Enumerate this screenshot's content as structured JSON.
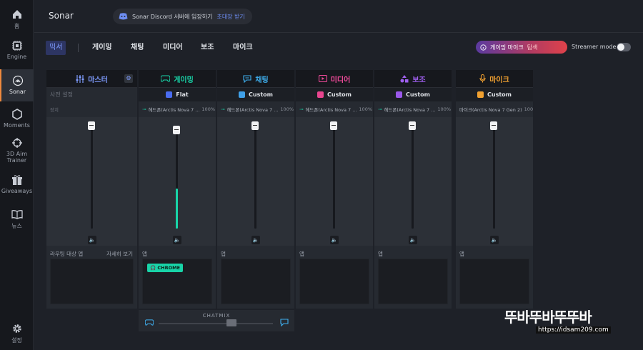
{
  "sidebar": {
    "items": [
      {
        "label": "홈",
        "icon": "home-icon"
      },
      {
        "label": "Engine",
        "icon": "chip-icon"
      },
      {
        "label": "Sonar",
        "icon": "sonar-icon"
      },
      {
        "label": "Moments",
        "icon": "hexagon-icon"
      },
      {
        "label": "3D Aim",
        "label2": "Trainer",
        "icon": "aim-icon"
      },
      {
        "label": "Giveaways",
        "icon": "gift-icon"
      },
      {
        "label": "뉴스",
        "icon": "book-icon"
      },
      {
        "label": "설정",
        "icon": "gear-icon"
      }
    ]
  },
  "header": {
    "title": "Sonar",
    "discord": {
      "text": "Sonar Discord 서버에 입장하기",
      "link": "초대장 받기"
    }
  },
  "tabs": [
    {
      "label": "믹서"
    },
    {
      "label": "게이밍"
    },
    {
      "label": "채팅"
    },
    {
      "label": "미디어"
    },
    {
      "label": "보조"
    },
    {
      "label": "마이크"
    }
  ],
  "gaming_mic": {
    "text": "게이밍 마이크",
    "action": "탐색"
  },
  "streamer_mode": "Streamer mode",
  "master": {
    "label": "마스터",
    "preset_label": "사전 설정",
    "device_label": "장치",
    "apps_label": "라우팅 대상 앱",
    "details_link": "자세히 보기"
  },
  "channels": [
    {
      "key": "gaming",
      "label": "게이밍",
      "color": "#18d4a8",
      "preset": "Flat",
      "preset_color": "#4a6cf0",
      "device": "헤드폰(Arctis Nova 7 ...",
      "pct": "100%",
      "apps_label": "앱",
      "app": "CHROME"
    },
    {
      "key": "chat",
      "label": "채팅",
      "color": "#3fb0f0",
      "preset": "Custom",
      "preset_color": "#3fa0e8",
      "device": "헤드폰(Arctis Nova 7 ...",
      "pct": "100%",
      "apps_label": "앱"
    },
    {
      "key": "media",
      "label": "미디어",
      "color": "#f04a9a",
      "preset": "Custom",
      "preset_color": "#e8458f",
      "device": "헤드폰(Arctis Nova 7 ...",
      "pct": "100%",
      "apps_label": "앱"
    },
    {
      "key": "aux",
      "label": "보조",
      "color": "#a060f0",
      "preset": "Custom",
      "preset_color": "#9a58ea",
      "device": "헤드폰(Arctis Nova 7 ...",
      "pct": "100%",
      "apps_label": "앱"
    },
    {
      "key": "mic",
      "label": "마이크",
      "color": "#f0a030",
      "preset": "Custom",
      "preset_color": "#f0a030",
      "device": "마이크(Arctis Nova 7 Gen 2)",
      "pct": "100%",
      "apps_label": "앱"
    }
  ],
  "levels": {
    "master": 1.0,
    "gaming": 0.95,
    "chat": 1.0,
    "media": 1.0,
    "aux": 1.0,
    "mic": 1.0
  },
  "gaming_meter": 0.42,
  "chatmix": {
    "label": "CHATMIX",
    "value": 0.5
  },
  "watermark": {
    "text": "뚜바뚜바뚜뚜바",
    "url": "https://idsam209.com"
  }
}
